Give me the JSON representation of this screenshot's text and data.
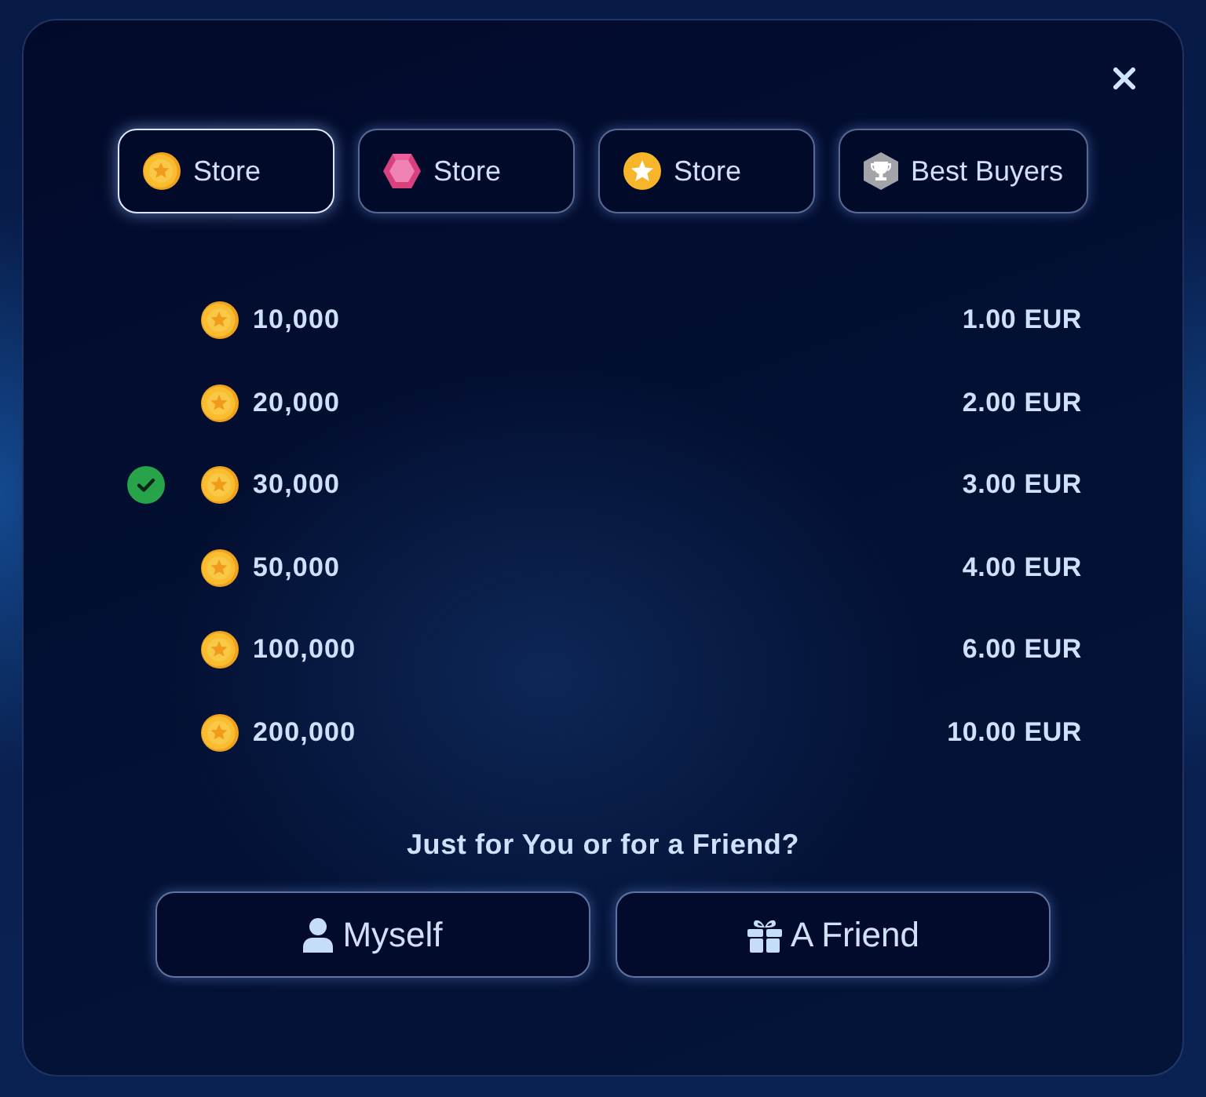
{
  "tabs": [
    {
      "label": "Store",
      "kind": "coin",
      "selected": true
    },
    {
      "label": "Store",
      "kind": "gem",
      "selected": false
    },
    {
      "label": "Store",
      "kind": "star",
      "selected": false
    },
    {
      "label": "Best Buyers",
      "kind": "trophy",
      "selected": false
    }
  ],
  "packages": [
    {
      "amount": "10,000",
      "price": "1.00 EUR",
      "selected": false
    },
    {
      "amount": "20,000",
      "price": "2.00 EUR",
      "selected": false
    },
    {
      "amount": "30,000",
      "price": "3.00 EUR",
      "selected": true
    },
    {
      "amount": "50,000",
      "price": "4.00 EUR",
      "selected": false
    },
    {
      "amount": "100,000",
      "price": "6.00 EUR",
      "selected": false
    },
    {
      "amount": "200,000",
      "price": "10.00 EUR",
      "selected": false
    }
  ],
  "recipient": {
    "question": "Just for You or for a Friend?",
    "options": [
      {
        "label": "Myself",
        "kind": "person"
      },
      {
        "label": "A Friend",
        "kind": "gift"
      }
    ]
  }
}
